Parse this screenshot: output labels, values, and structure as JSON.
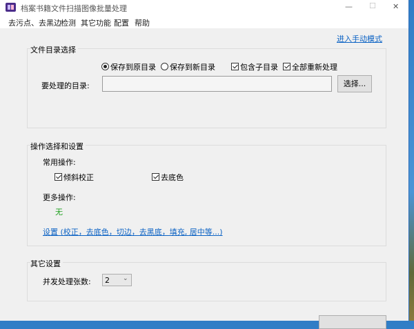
{
  "window": {
    "title": "档案书籍文件扫描图像批量处理",
    "minimize": "—",
    "maximize": "☐",
    "close": "✕"
  },
  "menu": [
    "去污点、去黑边",
    "检测",
    "其它功能",
    "配置",
    "帮助"
  ],
  "manual_mode_link": "进入手动模式",
  "dir_group": {
    "title": "文件目录选择",
    "radio_original": "保存到原目录",
    "radio_new": "保存到新目录",
    "include_subdirs": "包含子目录",
    "reprocess_all": "全部重新处理",
    "dir_label": "要处理的目录:",
    "dir_value": "",
    "browse": "选择..."
  },
  "ops_group": {
    "title": "操作选择和设置",
    "common_label": "常用操作:",
    "deskew": "倾斜校正",
    "remove_bg": "去底色",
    "more_label": "更多操作:",
    "more_value": "无",
    "settings_link": "设置 (校正，去底色，切边，去黑底，填充, 居中等...)"
  },
  "other_group": {
    "title": "其它设置",
    "concurrency_label": "并发处理张数:",
    "concurrency_value": "2"
  }
}
